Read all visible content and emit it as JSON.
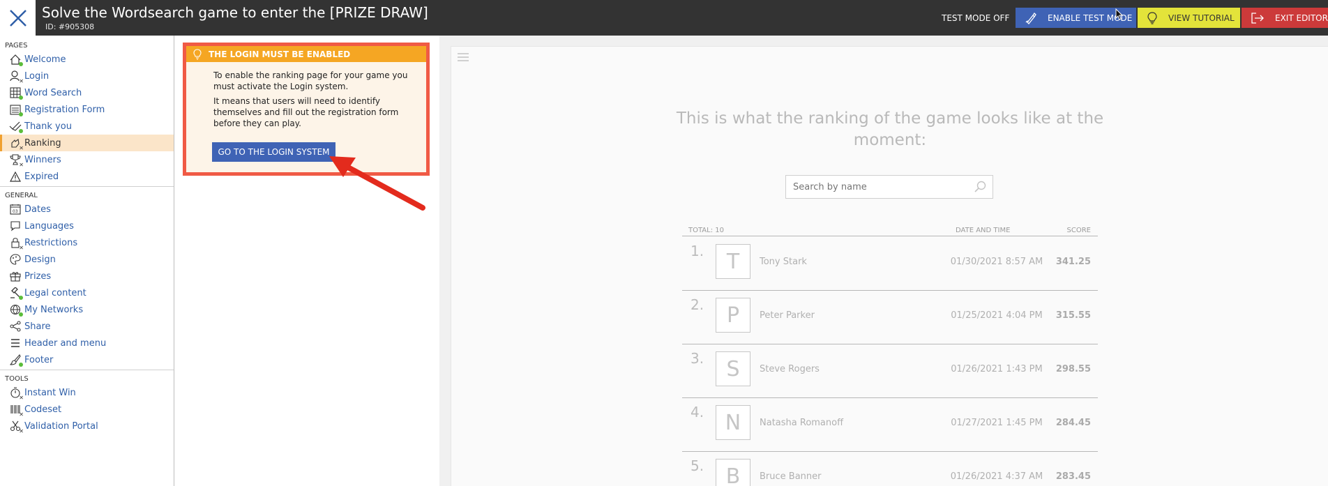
{
  "topbar": {
    "title": "Solve the Wordsearch game to enter the [PRIZE DRAW]",
    "id": "ID: #905308",
    "test_mode_status": "TEST MODE OFF",
    "enable_test_mode": "ENABLE TEST MODE",
    "view_tutorial": "VIEW TUTORIAL",
    "exit_editor": "EXIT EDITOR",
    "colors": {
      "bar": "#333333",
      "test": "#3f63b5",
      "tutorial": "#e3e33a",
      "exit": "#cc3a3a"
    }
  },
  "sidebar": {
    "pages_label": "PAGES",
    "general_label": "GENERAL",
    "tools_label": "TOOLS",
    "pages": [
      {
        "label": "Welcome",
        "icon": "home-icon",
        "status": "enabled"
      },
      {
        "label": "Login",
        "icon": "user-icon",
        "status": "disabled"
      },
      {
        "label": "Word Search",
        "icon": "grid-icon",
        "status": "enabled"
      },
      {
        "label": "Registration Form",
        "icon": "form-icon",
        "status": "enabled"
      },
      {
        "label": "Thank you",
        "icon": "check-icon",
        "status": "enabled"
      },
      {
        "label": "Ranking",
        "icon": "ranking-icon",
        "status": "disabled",
        "active": true
      },
      {
        "label": "Winners",
        "icon": "trophy-icon",
        "status": "disabled"
      },
      {
        "label": "Expired",
        "icon": "warning-icon",
        "status": "none"
      }
    ],
    "general": [
      {
        "label": "Dates",
        "icon": "calendar-icon"
      },
      {
        "label": "Languages",
        "icon": "speech-icon"
      },
      {
        "label": "Restrictions",
        "icon": "lock-icon",
        "status": "disabled"
      },
      {
        "label": "Design",
        "icon": "palette-icon"
      },
      {
        "label": "Prizes",
        "icon": "gift-icon"
      },
      {
        "label": "Legal content",
        "icon": "gavel-icon",
        "status": "enabled"
      },
      {
        "label": "My Networks",
        "icon": "globe-icon",
        "status": "enabled"
      },
      {
        "label": "Share",
        "icon": "share-icon"
      },
      {
        "label": "Header and menu",
        "icon": "menu-icon"
      },
      {
        "label": "Footer",
        "icon": "brush-icon",
        "status": "enabled"
      }
    ],
    "tools": [
      {
        "label": "Instant Win",
        "icon": "timer-icon",
        "status": "disabled"
      },
      {
        "label": "Codeset",
        "icon": "barcode-icon",
        "status": "disabled"
      },
      {
        "label": "Validation Portal",
        "icon": "scissors-icon",
        "status": "disabled"
      }
    ]
  },
  "alert": {
    "title": "THE LOGIN MUST BE ENABLED",
    "para1": "To enable the ranking page for your game you must activate the Login system.",
    "para2": "It means that users will need to identify themselves and fill out the registration form before they can play.",
    "button": "GO TO THE LOGIN SYSTEM",
    "colors": {
      "border": "#f05a45",
      "header": "#f5a623",
      "button": "#3f63b5"
    }
  },
  "preview": {
    "heading": "This is what the ranking of the game looks like at the moment:",
    "search_placeholder": "Search by name",
    "col_total": "TOTAL: 10",
    "col_date": "DATE AND TIME",
    "col_score": "SCORE",
    "rows": [
      {
        "rank": "1.",
        "initial": "T",
        "name": "Tony Stark",
        "date": "01/30/2021 8:57 AM",
        "score": "341.25"
      },
      {
        "rank": "2.",
        "initial": "P",
        "name": "Peter Parker",
        "date": "01/25/2021 4:04 PM",
        "score": "315.55"
      },
      {
        "rank": "3.",
        "initial": "S",
        "name": "Steve Rogers",
        "date": "01/26/2021 1:43 PM",
        "score": "298.55"
      },
      {
        "rank": "4.",
        "initial": "N",
        "name": "Natasha Romanoff",
        "date": "01/27/2021 1:45 PM",
        "score": "284.45"
      },
      {
        "rank": "5.",
        "initial": "B",
        "name": "Bruce Banner",
        "date": "01/26/2021 4:37 AM",
        "score": "283.45"
      }
    ]
  }
}
